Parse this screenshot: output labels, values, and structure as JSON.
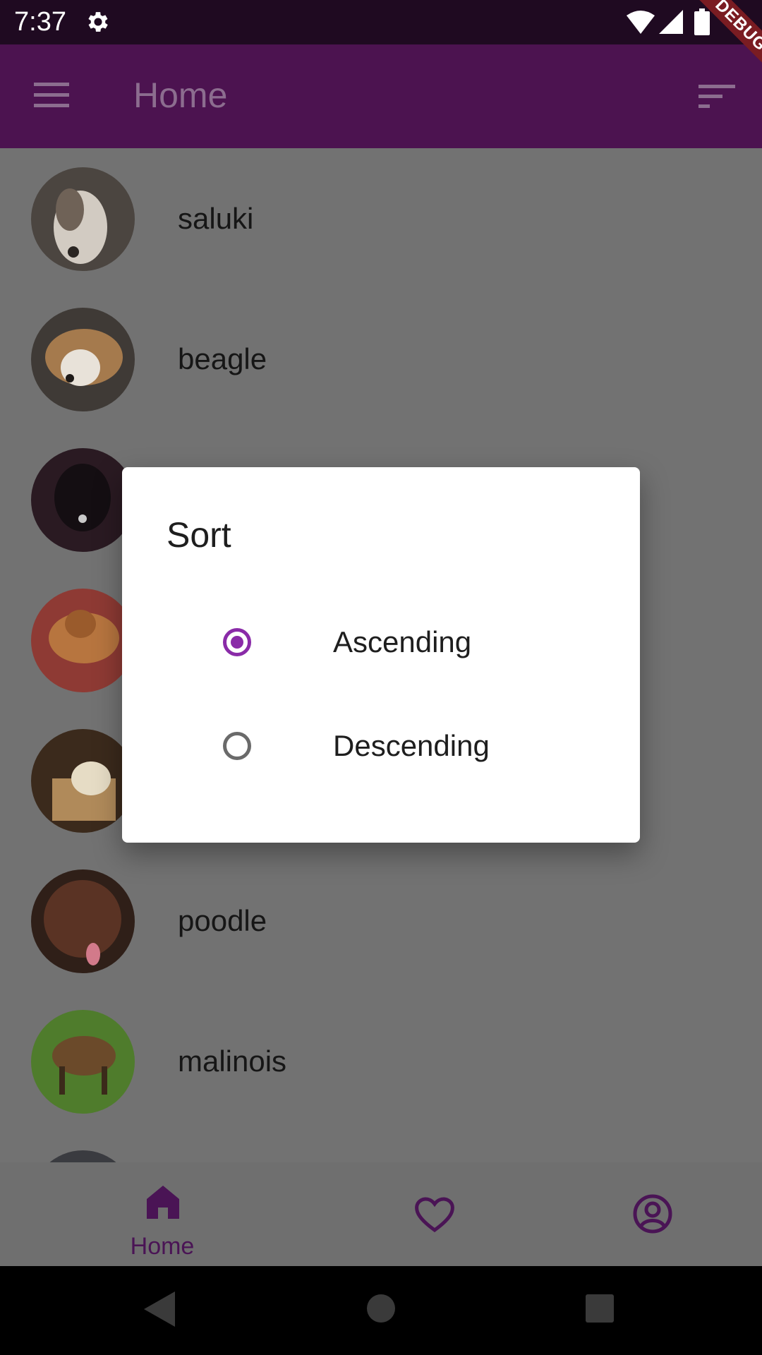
{
  "status_bar": {
    "time": "7:37",
    "icons": [
      "gear-icon",
      "wifi-icon",
      "signal-icon",
      "battery-icon"
    ]
  },
  "debug_banner": "DEBUG",
  "app_bar": {
    "title": "Home",
    "menu_icon": "menu-icon",
    "sort_icon": "sort-icon"
  },
  "breeds": [
    {
      "name": "saluki"
    },
    {
      "name": "beagle"
    },
    {
      "name": ""
    },
    {
      "name": ""
    },
    {
      "name": ""
    },
    {
      "name": "poodle"
    },
    {
      "name": "malinois"
    }
  ],
  "dialog": {
    "title": "Sort",
    "options": [
      {
        "label": "Ascending",
        "selected": true
      },
      {
        "label": "Descending",
        "selected": false
      }
    ]
  },
  "bottom_nav": {
    "items": [
      {
        "label": "Home",
        "icon": "home-icon",
        "active": true
      },
      {
        "label": "",
        "icon": "heart-icon",
        "active": false
      },
      {
        "label": "",
        "icon": "account-icon",
        "active": false
      }
    ]
  },
  "colors": {
    "app_bar": "#4c1350",
    "status_bar": "#1f0a21",
    "accent": "#8a2ba8",
    "nav_active": "#4a1455"
  }
}
